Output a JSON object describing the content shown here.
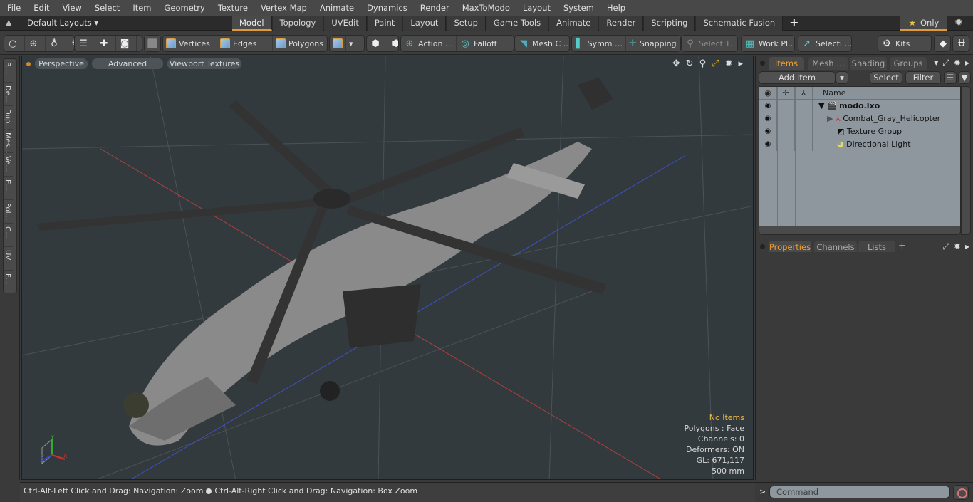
{
  "menu": [
    "File",
    "Edit",
    "View",
    "Select",
    "Item",
    "Geometry",
    "Texture",
    "Vertex Map",
    "Animate",
    "Dynamics",
    "Render",
    "MaxToModo",
    "Layout",
    "System",
    "Help"
  ],
  "layouts": {
    "label": "Default Layouts ▾",
    "up_icon": "▲"
  },
  "tabs": [
    "Model",
    "Topology",
    "UVEdit",
    "Paint",
    "Layout",
    "Setup",
    "Game Tools",
    "Animate",
    "Render",
    "Scripting",
    "Schematic Fusion"
  ],
  "active_tab": "Model",
  "tab_add": "+",
  "only": {
    "star": "★",
    "label": "Only"
  },
  "toolbar": {
    "vertices": "Vertices",
    "edges": "Edges",
    "polygons": "Polygons",
    "action": "Action  …",
    "falloff": "Falloff",
    "mesh": "Mesh C …",
    "symm": "Symm …",
    "snapping": "Snapping",
    "select_t": "Select T…",
    "workplane": "Work Pl…",
    "selecti": "Selecti …",
    "kits": "Kits"
  },
  "left_tools": [
    "B…",
    "De…",
    "Dup…",
    "Mes…",
    "Ve…",
    "E…",
    "Pol…",
    "C…",
    "UV",
    "F…"
  ],
  "viewport": {
    "view": "Perspective",
    "shading": "Advanced",
    "textures": "Viewport Textures",
    "info": {
      "selection": "No Items",
      "polygons": "Polygons : Face",
      "channels": "Channels: 0",
      "deformers": "Deformers: ON",
      "gl": "GL: 671,117",
      "scale": "500 mm"
    },
    "axis": {
      "x": "X",
      "y": "Y",
      "z": "Z"
    }
  },
  "status": {
    "left": "Ctrl-Alt-Left Click and Drag: Navigation: Zoom",
    "right": "Ctrl-Alt-Right Click and Drag: Navigation: Box Zoom"
  },
  "items_panel": {
    "tabs": [
      "Items",
      "Mesh …",
      "Shading",
      "Groups"
    ],
    "active": "Items",
    "add_item": "Add Item",
    "select": "Select",
    "filter": "Filter",
    "column_name": "Name",
    "tree": [
      {
        "label": "modo.lxo",
        "level": 0,
        "bold": true,
        "icon": "scene-icon",
        "expander": "▼"
      },
      {
        "label": "Combat_Gray_Helicopter",
        "level": 1,
        "icon": "mesh-locator-icon",
        "expander": "▶"
      },
      {
        "label": "Texture Group",
        "level": 1,
        "icon": "texture-group-icon",
        "expander": ""
      },
      {
        "label": "Directional Light",
        "level": 1,
        "icon": "light-icon",
        "expander": ""
      }
    ]
  },
  "props_panel": {
    "tabs": [
      "Properties",
      "Channels",
      "Lists"
    ],
    "active": "Properties",
    "add": "+"
  },
  "command": {
    "prompt": ">",
    "placeholder": "Command"
  },
  "colors": {
    "accent": "#e09a3a",
    "viewport_bg": "#323a3e",
    "no_items": "#f0b840"
  }
}
